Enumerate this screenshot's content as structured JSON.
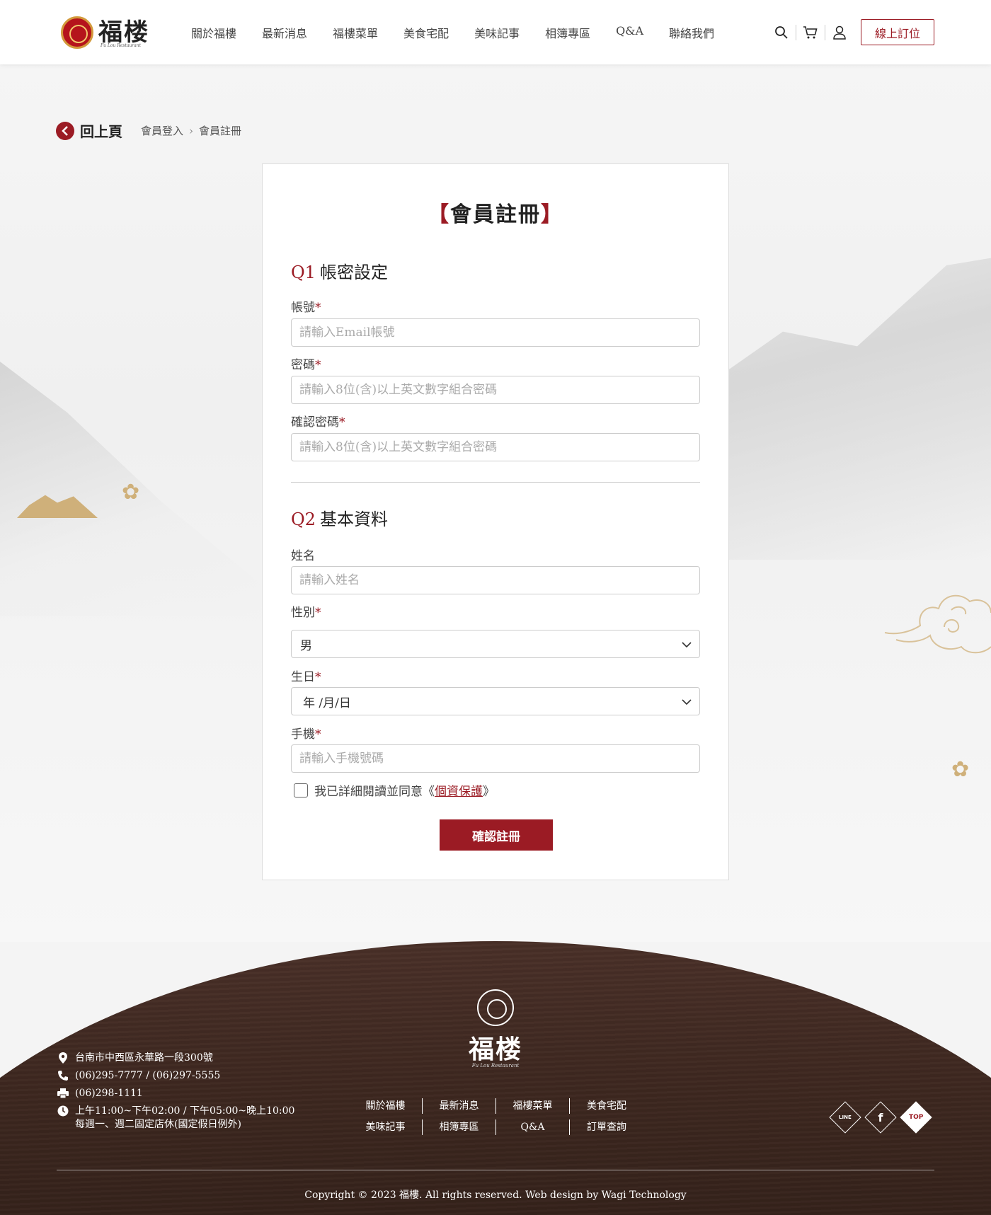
{
  "header": {
    "logo_text": "福楼",
    "logo_sub": "Fu Lou Restaurant",
    "nav": [
      "關於福樓",
      "最新消息",
      "福樓菜單",
      "美食宅配",
      "美味記事",
      "相簿專區",
      "Q&A",
      "聯絡我們"
    ],
    "icons": [
      "search-icon",
      "cart-icon",
      "user-icon"
    ],
    "book_button": "線上訂位"
  },
  "breadcrumb": {
    "back_label": "回上頁",
    "items": [
      "會員登入",
      "會員註冊"
    ]
  },
  "form": {
    "title_open": "【",
    "title": "會員註冊",
    "title_close": "】",
    "section1": {
      "q": "Q1",
      "title": "帳密設定"
    },
    "account": {
      "label": "帳號",
      "required": "*",
      "placeholder": "請輸入Email帳號"
    },
    "password": {
      "label": "密碼",
      "required": "*",
      "placeholder": "請輸入8位(含)以上英文數字組合密碼"
    },
    "confirm_password": {
      "label": "確認密碼",
      "required": "*",
      "placeholder": "請輸入8位(含)以上英文數字組合密碼"
    },
    "section2": {
      "q": "Q2",
      "title": "基本資料"
    },
    "name": {
      "label": "姓名",
      "placeholder": "請輸入姓名"
    },
    "gender": {
      "label": "性別",
      "required": "*",
      "value": "男"
    },
    "birthday": {
      "label": "生日",
      "required": "*",
      "value": "年 /月/日"
    },
    "phone": {
      "label": "手機",
      "required": "*",
      "placeholder": "請輸入手機號碼"
    },
    "agree_text": "我已詳細閱讀並同意《",
    "privacy_link": "個資保護",
    "agree_close": "》",
    "submit": "確認註冊"
  },
  "footer": {
    "logo_text": "福楼",
    "logo_sub": "Fu Lou Restaurant",
    "address": "台南市中西區永華路一段300號",
    "phone": "(06)295-7777 / (06)297-5555",
    "fax": "(06)298-1111",
    "hours_1": "上午11:00~下午02:00 / 下午05:00~晚上10:00",
    "hours_2": "每週一、週二固定店休(國定假日例外)",
    "links_row1": [
      "關於福樓",
      "最新消息",
      "福樓菜單",
      "美食宅配"
    ],
    "links_row2": [
      "美味記事",
      "相簿專區",
      "Q&A",
      "訂單查詢"
    ],
    "social": {
      "line": "LINE",
      "facebook": "f",
      "top": "TOP"
    },
    "copyright": "Copyright © 2023 福樓. All rights reserved. Web design by Wagi Technology"
  },
  "colors": {
    "brand": "#9b1b24",
    "gold": "#cfb07a",
    "footer_bg": "#3e2820"
  }
}
